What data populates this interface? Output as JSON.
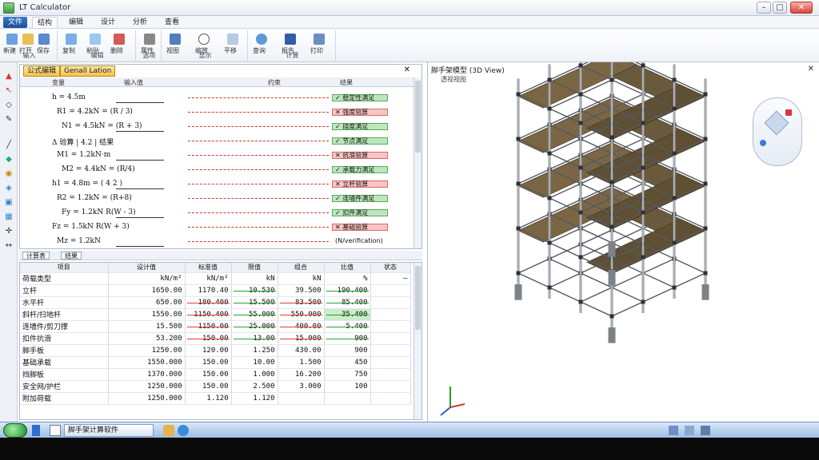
{
  "window": {
    "title": "LT Calculator",
    "min": "–",
    "max": "□",
    "close": "✕"
  },
  "menu": {
    "home": "文件",
    "tabs": [
      "结构",
      "编辑",
      "设计",
      "分析",
      "查看"
    ]
  },
  "ribbon": {
    "groups": [
      {
        "label": "输入",
        "items": [
          "新建",
          "打开",
          "保存"
        ]
      },
      {
        "label": "编辑",
        "items": [
          "复制",
          "粘贴",
          "删除"
        ]
      },
      {
        "label": "选项",
        "items": [
          "属性"
        ]
      },
      {
        "label": "显示",
        "items": [
          "视图",
          "缩放",
          "平移"
        ]
      },
      {
        "label": "计算",
        "items": [
          "查询",
          "报告",
          "打印"
        ]
      }
    ]
  },
  "formula_pane": {
    "tabs": [
      "公式编辑",
      "Genall Lation"
    ],
    "col_heads": [
      "变量",
      "输入值",
      "约束",
      "结果"
    ],
    "rows": [
      "h = 4.5m  ",
      "R1 = 4.2kN  = (R / 3)",
      "N1 = 4.5kN = (R + 3)",
      "Δ 验算 | 4.2 | 结果",
      "M1 = 1.2kN·m",
      "M2 = 4.4kN = (R/4)",
      "h1 = 4.8m  = ( 4 2 )",
      "R2 = 1.2kN  = (R+8)",
      "Fy = 1.2kN  R(W - 3)",
      "Fz = 1.5kN  R(W + 3)",
      "Mz = 1.2kN"
    ],
    "results": [
      "✓ 稳定性满足",
      "✕ 强度验算",
      "✓ 挠度满足",
      "✓ 节点满足",
      "✕ 抗滑验算",
      "✓ 承载力满足",
      "✕ 立杆验算",
      "✓ 连墙件满足",
      "✓ 扣件满足",
      "✕ 基础验算",
      "(N/verification)"
    ]
  },
  "sheet_tabs": [
    "计算表",
    "结果"
  ],
  "table": {
    "headers": [
      "项目",
      "设计值",
      "标准值",
      "限值",
      "组合",
      "比值",
      "状态"
    ],
    "rows": [
      [
        "荷载类型",
        "kN/m²",
        "kN/m²",
        "kN",
        "kN",
        "%",
        "—"
      ],
      [
        "立杆",
        "1650.00",
        "1170.40",
        "10.530",
        "39.500",
        "190.400",
        ""
      ],
      [
        "水平杆",
        "650.00",
        "180.400",
        "15.500",
        "83.500",
        "85.400",
        ""
      ],
      [
        "斜杆/扫地杆",
        "1550.00",
        "1150.400",
        "55.000",
        "550.000",
        "35.400",
        ""
      ],
      [
        "连墙件/剪刀撑",
        "15.500",
        "1150.00",
        "25.000",
        "400.00",
        "5.400",
        ""
      ],
      [
        "扣件抗滑",
        "53.200",
        "150.00",
        "13.00",
        "15.000",
        "900",
        ""
      ],
      [
        "脚手板",
        "1250.00",
        "120.00",
        "1.250",
        "430.00",
        "900",
        ""
      ],
      [
        "基础承载",
        "1550.000",
        "150.00",
        "10.00",
        "1.500",
        "450",
        ""
      ],
      [
        "挡脚板",
        "1370.000",
        "150.00",
        "1.000",
        "16.200",
        "750",
        ""
      ],
      [
        "安全网/护栏",
        "1250.000",
        "150.00",
        "2.500",
        "3.000",
        "100",
        ""
      ],
      [
        "附加荷载",
        "1250.000",
        "1.120",
        "1.120",
        "",
        "",
        ""
      ]
    ]
  },
  "viewport": {
    "title": "脚手架模型 (3D View)",
    "subtitle": "透视视图",
    "close": "✕"
  },
  "taskbar": {
    "items": [
      "脚手架计算软件"
    ]
  },
  "colors": {
    "ribbon_active": "#1c4f9c",
    "tab_orange": "#f5c24a",
    "hl_red": "#e23b3b",
    "hl_green": "#2aa02a",
    "scaffold_pole": "#8a8f96",
    "scaffold_plank": "#6b5a3a"
  }
}
